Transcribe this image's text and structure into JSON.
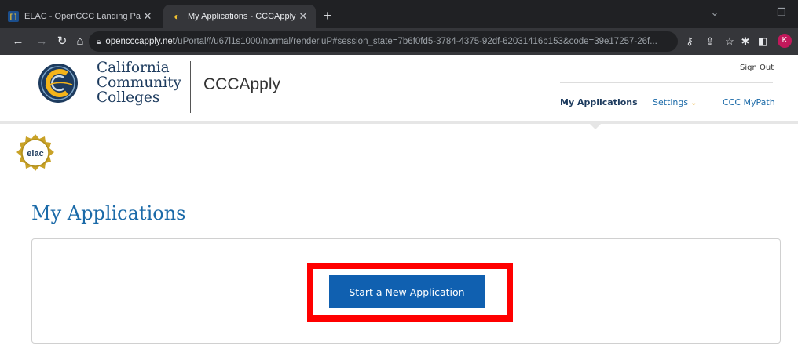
{
  "browser": {
    "tabs": [
      {
        "title": "ELAC - OpenCCC Landing Page",
        "active": false
      },
      {
        "title": "My Applications - CCCApply",
        "active": true
      }
    ],
    "url_host": "opencccapply.net",
    "url_path": "/uPortal/f/u67l1s1000/normal/render.uP#session_state=7b6f0fd5-3784-4375-92df-62031416b153&code=39e17257-26f...",
    "profile_initial": "K"
  },
  "header": {
    "org_line1": "California",
    "org_line2": "Community",
    "org_line3": "Colleges",
    "app_name": "CCCApply",
    "sign_out": "Sign Out",
    "nav": {
      "my_applications": "My Applications",
      "settings": "Settings",
      "my_path": "CCC MyPath"
    }
  },
  "college_logo_text": "elac",
  "main": {
    "title": "My Applications",
    "start_button": "Start a New Application"
  },
  "colors": {
    "primary_button": "#1060b0",
    "link": "#1b6aa8",
    "highlight": "#ff0000",
    "accent_gold": "#e8a317"
  }
}
